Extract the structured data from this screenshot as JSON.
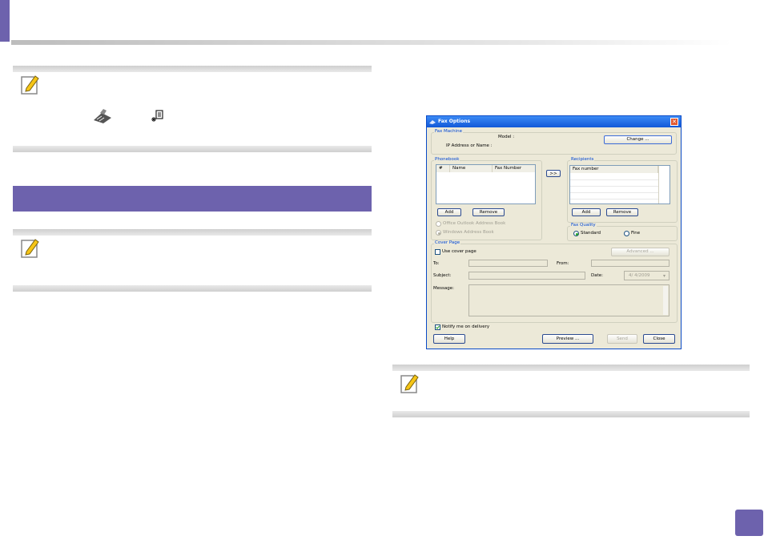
{
  "colors": {
    "accent": "#6d62ad",
    "dialog_bg": "#ece9d8",
    "titlebar": "#1158d8"
  },
  "icons": [
    "note-pencil-icon",
    "fax-machine-icon",
    "fax-options-icon",
    "close-icon",
    "checkmark-icon"
  ],
  "dialog": {
    "title": "Fax Options",
    "fax_machine": {
      "group_label": "Fax Machine",
      "model_label": "Model :",
      "ip_label": "IP Address or Name :",
      "change_button": "Change ..."
    },
    "phonebook": {
      "group_label": "Phonebook",
      "columns": [
        "#",
        "Name",
        "Fax Number"
      ],
      "add_button": "Add",
      "remove_button": "Remove",
      "outlook_option": "Office Outlook Address Book",
      "windows_option": "Windows Address Book"
    },
    "move_button": ">>",
    "recipients": {
      "group_label": "Recipients",
      "columns": [
        "Fax number"
      ],
      "add_button": "Add",
      "remove_button": "Remove"
    },
    "fax_quality": {
      "group_label": "Fax Quality",
      "standard": "Standard",
      "fine": "Fine"
    },
    "cover_page": {
      "group_label": "Cover Page",
      "use_cover": "Use cover page",
      "advanced_button": "Advanced ...",
      "to_label": "To:",
      "from_label": "From:",
      "subject_label": "Subject:",
      "date_label": "Date:",
      "date_value": "4/ 4/2009",
      "message_label": "Message:"
    },
    "notify": "Notify me on delivery",
    "help_button": "Help",
    "preview_button": "Preview ...",
    "send_button": "Send",
    "close_button": "Close"
  }
}
